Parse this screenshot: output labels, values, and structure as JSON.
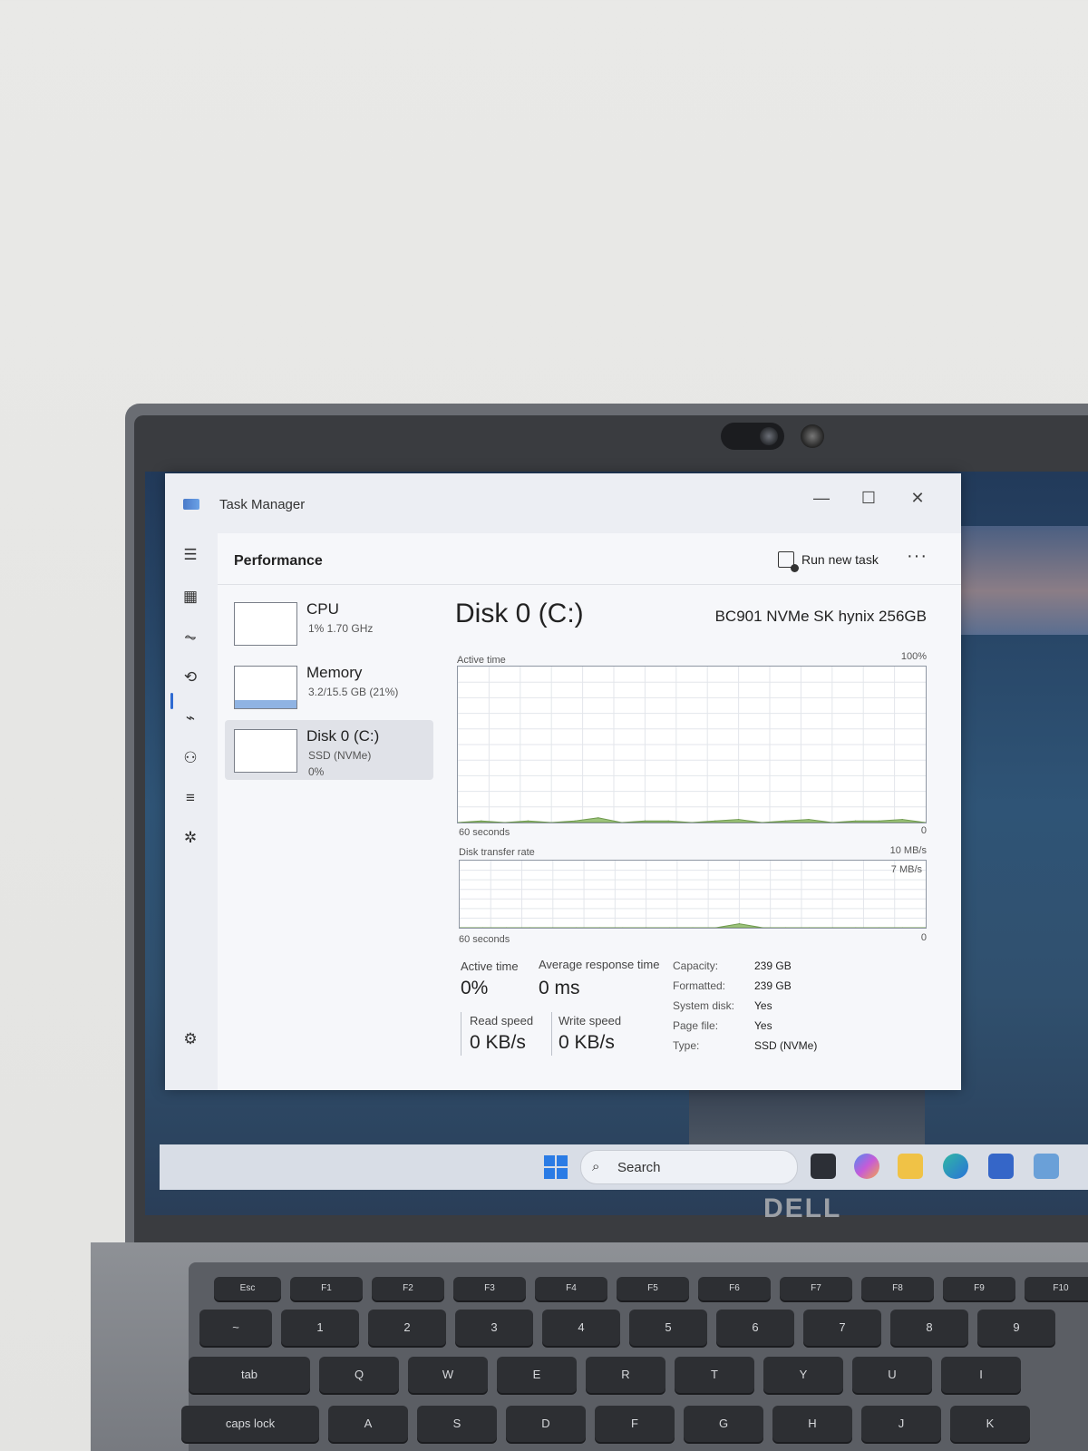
{
  "window": {
    "title": "Task Manager",
    "controls": {
      "minimize": "—",
      "maximize": "☐",
      "close": "✕"
    }
  },
  "nav": {
    "items": [
      {
        "icon": "hamburger-icon"
      },
      {
        "icon": "processes-icon"
      },
      {
        "icon": "performance-icon",
        "active": true
      },
      {
        "icon": "app-history-icon"
      },
      {
        "icon": "startup-apps-icon"
      },
      {
        "icon": "users-icon"
      },
      {
        "icon": "details-icon"
      },
      {
        "icon": "services-icon"
      },
      {
        "icon": "settings-icon"
      }
    ]
  },
  "header": {
    "page_title": "Performance",
    "run_new_task": "Run new task",
    "more": "···"
  },
  "resources": [
    {
      "name": "CPU",
      "sub": "1%  1.70 GHz",
      "sub2": ""
    },
    {
      "name": "Memory",
      "sub": "3.2/15.5 GB (21%)",
      "sub2": ""
    },
    {
      "name": "Disk 0 (C:)",
      "sub": "SSD (NVMe)",
      "sub2": "0%"
    }
  ],
  "disk": {
    "title": "Disk 0 (C:)",
    "model": "BC901 NVMe SK hynix 256GB",
    "active_time_graph": {
      "label": "Active time",
      "max_label": "100%",
      "time_label": "60 seconds",
      "min_label": "0"
    },
    "transfer_graph": {
      "label": "Disk transfer rate",
      "max_label": "10 MB/s",
      "inner_label": "7 MB/s",
      "time_label": "60 seconds",
      "min_label": "0"
    },
    "stats": {
      "active_time_label": "Active time",
      "active_time_value": "0%",
      "avg_response_label": "Average response time",
      "avg_response_value": "0 ms",
      "read_label": "Read speed",
      "read_value": "0 KB/s",
      "write_label": "Write speed",
      "write_value": "0 KB/s"
    },
    "info": [
      {
        "label": "Capacity:",
        "value": "239 GB"
      },
      {
        "label": "Formatted:",
        "value": "239 GB"
      },
      {
        "label": "System disk:",
        "value": "Yes"
      },
      {
        "label": "Page file:",
        "value": "Yes"
      },
      {
        "label": "Type:",
        "value": "SSD (NVMe)"
      }
    ]
  },
  "chart_data": [
    {
      "type": "area",
      "title": "Active time",
      "ylim": [
        0,
        100
      ],
      "x": [
        0,
        3,
        6,
        9,
        12,
        15,
        18,
        21,
        24,
        27,
        30,
        33,
        36,
        39,
        42,
        45,
        48,
        51,
        54,
        57,
        60
      ],
      "values": [
        0,
        1,
        0,
        1,
        0,
        1,
        3,
        0,
        1,
        1,
        0,
        1,
        2,
        0,
        1,
        2,
        0,
        1,
        1,
        2,
        0
      ]
    },
    {
      "type": "area",
      "title": "Disk transfer rate",
      "ylim": [
        0,
        10
      ],
      "x": [
        0,
        3,
        6,
        9,
        12,
        15,
        18,
        21,
        24,
        27,
        30,
        33,
        36,
        39,
        42,
        45,
        48,
        51,
        54,
        57,
        60
      ],
      "values": [
        0,
        0,
        0,
        0,
        0,
        0,
        0,
        0,
        0,
        0,
        0,
        0,
        0.6,
        0,
        0,
        0,
        0,
        0,
        0,
        0,
        0
      ]
    }
  ],
  "taskbar": {
    "search_placeholder": "Search",
    "icons": [
      "start-icon",
      "task-view-icon",
      "copilot-icon",
      "file-explorer-icon",
      "edge-icon",
      "store-icon",
      "task-manager-icon"
    ]
  },
  "brand": {
    "logo": "DELL"
  },
  "keyboard": {
    "fn_row": [
      "Esc",
      "F1",
      "F2",
      "F3",
      "F4",
      "F5",
      "F6",
      "F7",
      "F8",
      "F9",
      "F10"
    ],
    "num_row": [
      "~",
      "1",
      "2",
      "3",
      "4",
      "5",
      "6",
      "7",
      "8",
      "9"
    ],
    "top_row": [
      "tab",
      "Q",
      "W",
      "E",
      "R",
      "T",
      "Y",
      "U",
      "I"
    ],
    "home_row": [
      "caps lock",
      "A",
      "S",
      "D",
      "F",
      "G",
      "H",
      "J",
      "K"
    ]
  },
  "colors": {
    "accent": "#2e6ad1",
    "graph_fill": "#9cc37a",
    "graph_line": "#6f9a4e"
  }
}
